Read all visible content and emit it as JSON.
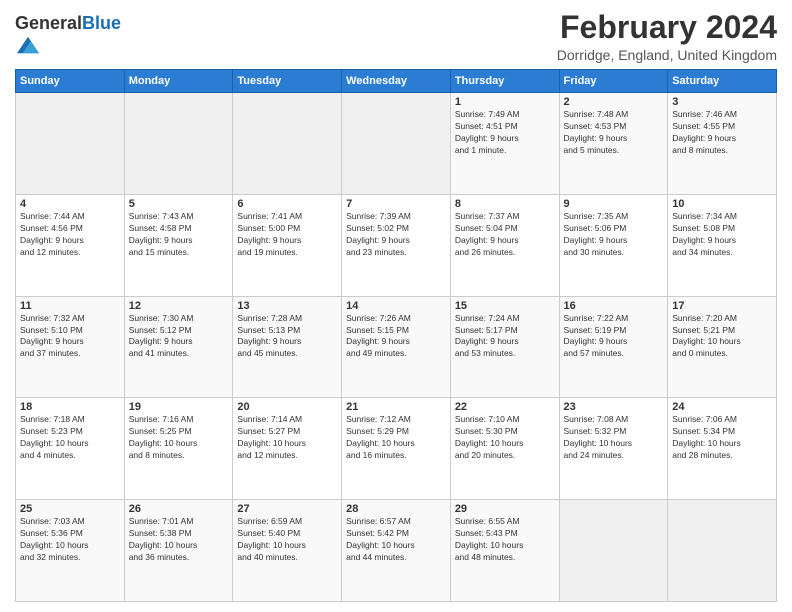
{
  "logo": {
    "general": "General",
    "blue": "Blue"
  },
  "header": {
    "title": "February 2024",
    "subtitle": "Dorridge, England, United Kingdom"
  },
  "days_of_week": [
    "Sunday",
    "Monday",
    "Tuesday",
    "Wednesday",
    "Thursday",
    "Friday",
    "Saturday"
  ],
  "weeks": [
    [
      {
        "day": "",
        "info": ""
      },
      {
        "day": "",
        "info": ""
      },
      {
        "day": "",
        "info": ""
      },
      {
        "day": "",
        "info": ""
      },
      {
        "day": "1",
        "info": "Sunrise: 7:49 AM\nSunset: 4:51 PM\nDaylight: 9 hours\nand 1 minute."
      },
      {
        "day": "2",
        "info": "Sunrise: 7:48 AM\nSunset: 4:53 PM\nDaylight: 9 hours\nand 5 minutes."
      },
      {
        "day": "3",
        "info": "Sunrise: 7:46 AM\nSunset: 4:55 PM\nDaylight: 9 hours\nand 8 minutes."
      }
    ],
    [
      {
        "day": "4",
        "info": "Sunrise: 7:44 AM\nSunset: 4:56 PM\nDaylight: 9 hours\nand 12 minutes."
      },
      {
        "day": "5",
        "info": "Sunrise: 7:43 AM\nSunset: 4:58 PM\nDaylight: 9 hours\nand 15 minutes."
      },
      {
        "day": "6",
        "info": "Sunrise: 7:41 AM\nSunset: 5:00 PM\nDaylight: 9 hours\nand 19 minutes."
      },
      {
        "day": "7",
        "info": "Sunrise: 7:39 AM\nSunset: 5:02 PM\nDaylight: 9 hours\nand 23 minutes."
      },
      {
        "day": "8",
        "info": "Sunrise: 7:37 AM\nSunset: 5:04 PM\nDaylight: 9 hours\nand 26 minutes."
      },
      {
        "day": "9",
        "info": "Sunrise: 7:35 AM\nSunset: 5:06 PM\nDaylight: 9 hours\nand 30 minutes."
      },
      {
        "day": "10",
        "info": "Sunrise: 7:34 AM\nSunset: 5:08 PM\nDaylight: 9 hours\nand 34 minutes."
      }
    ],
    [
      {
        "day": "11",
        "info": "Sunrise: 7:32 AM\nSunset: 5:10 PM\nDaylight: 9 hours\nand 37 minutes."
      },
      {
        "day": "12",
        "info": "Sunrise: 7:30 AM\nSunset: 5:12 PM\nDaylight: 9 hours\nand 41 minutes."
      },
      {
        "day": "13",
        "info": "Sunrise: 7:28 AM\nSunset: 5:13 PM\nDaylight: 9 hours\nand 45 minutes."
      },
      {
        "day": "14",
        "info": "Sunrise: 7:26 AM\nSunset: 5:15 PM\nDaylight: 9 hours\nand 49 minutes."
      },
      {
        "day": "15",
        "info": "Sunrise: 7:24 AM\nSunset: 5:17 PM\nDaylight: 9 hours\nand 53 minutes."
      },
      {
        "day": "16",
        "info": "Sunrise: 7:22 AM\nSunset: 5:19 PM\nDaylight: 9 hours\nand 57 minutes."
      },
      {
        "day": "17",
        "info": "Sunrise: 7:20 AM\nSunset: 5:21 PM\nDaylight: 10 hours\nand 0 minutes."
      }
    ],
    [
      {
        "day": "18",
        "info": "Sunrise: 7:18 AM\nSunset: 5:23 PM\nDaylight: 10 hours\nand 4 minutes."
      },
      {
        "day": "19",
        "info": "Sunrise: 7:16 AM\nSunset: 5:25 PM\nDaylight: 10 hours\nand 8 minutes."
      },
      {
        "day": "20",
        "info": "Sunrise: 7:14 AM\nSunset: 5:27 PM\nDaylight: 10 hours\nand 12 minutes."
      },
      {
        "day": "21",
        "info": "Sunrise: 7:12 AM\nSunset: 5:29 PM\nDaylight: 10 hours\nand 16 minutes."
      },
      {
        "day": "22",
        "info": "Sunrise: 7:10 AM\nSunset: 5:30 PM\nDaylight: 10 hours\nand 20 minutes."
      },
      {
        "day": "23",
        "info": "Sunrise: 7:08 AM\nSunset: 5:32 PM\nDaylight: 10 hours\nand 24 minutes."
      },
      {
        "day": "24",
        "info": "Sunrise: 7:06 AM\nSunset: 5:34 PM\nDaylight: 10 hours\nand 28 minutes."
      }
    ],
    [
      {
        "day": "25",
        "info": "Sunrise: 7:03 AM\nSunset: 5:36 PM\nDaylight: 10 hours\nand 32 minutes."
      },
      {
        "day": "26",
        "info": "Sunrise: 7:01 AM\nSunset: 5:38 PM\nDaylight: 10 hours\nand 36 minutes."
      },
      {
        "day": "27",
        "info": "Sunrise: 6:59 AM\nSunset: 5:40 PM\nDaylight: 10 hours\nand 40 minutes."
      },
      {
        "day": "28",
        "info": "Sunrise: 6:57 AM\nSunset: 5:42 PM\nDaylight: 10 hours\nand 44 minutes."
      },
      {
        "day": "29",
        "info": "Sunrise: 6:55 AM\nSunset: 5:43 PM\nDaylight: 10 hours\nand 48 minutes."
      },
      {
        "day": "",
        "info": ""
      },
      {
        "day": "",
        "info": ""
      }
    ]
  ]
}
